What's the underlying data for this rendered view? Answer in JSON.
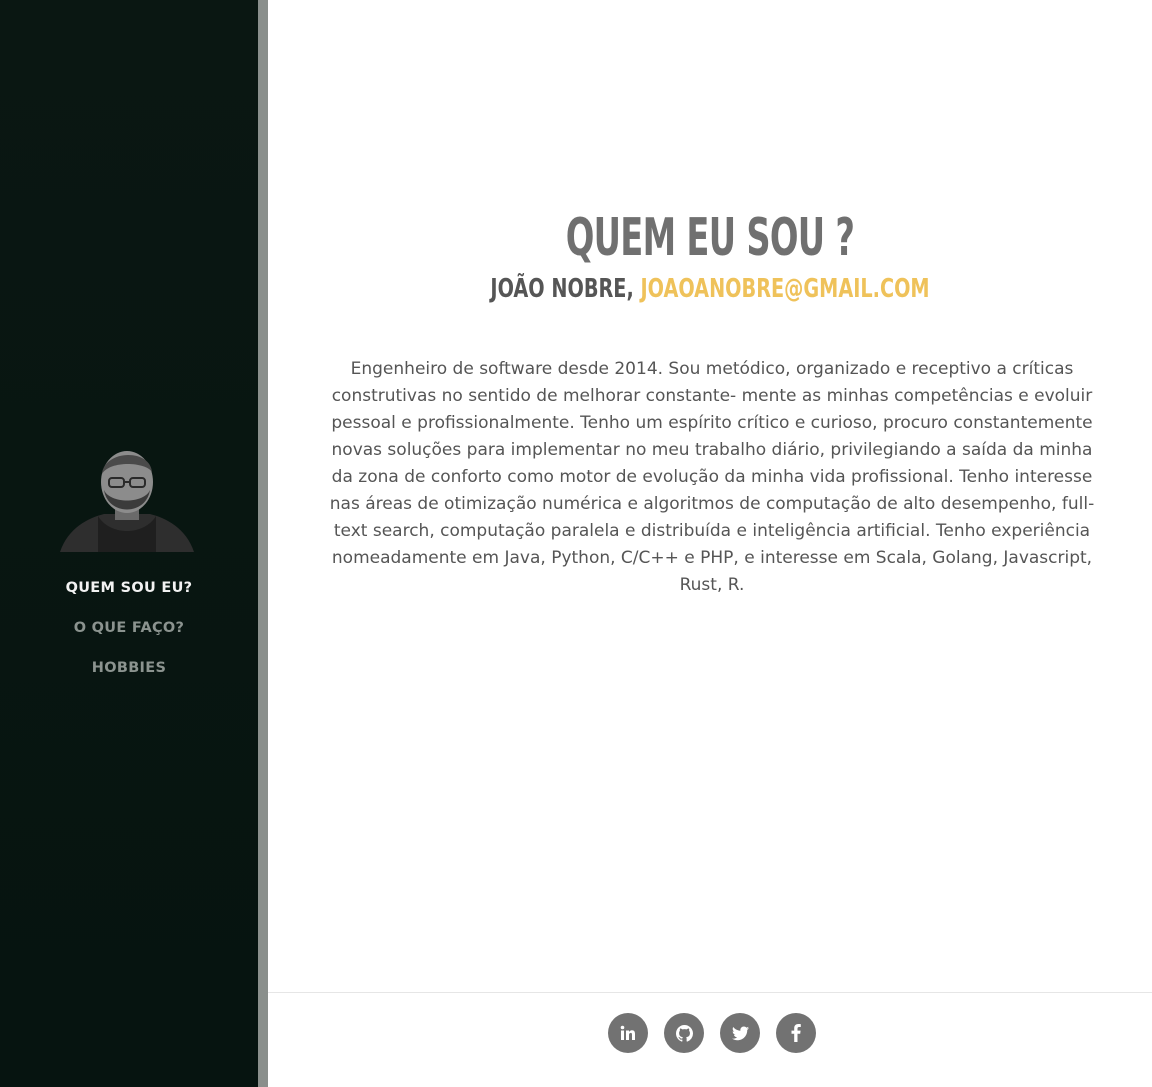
{
  "sidebar": {
    "nav": [
      {
        "label": "QUEM SOU EU?",
        "active": true
      },
      {
        "label": "O QUE FAÇO?",
        "active": false
      },
      {
        "label": "HOBBIES",
        "active": false
      }
    ]
  },
  "main": {
    "heading": "QUEM EU SOU ?",
    "name": "JOÃO NOBRE, ",
    "email": "JOAOANOBRE@GMAIL.COM",
    "bio": "Engenheiro de software desde 2014. Sou metódico, organizado e receptivo a críticas construtivas no sentido de melhorar constante- mente as minhas competências e evoluir pessoal e profissionalmente. Tenho um espírito crítico e curioso, procuro constantemente novas soluções para implementar no meu trabalho diário, privilegiando a saída da minha da zona de conforto como motor de evolução da minha vida profissional. Tenho interesse nas áreas de otimização numérica e algoritmos de computação de alto desempenho, full-text search, computação paralela e distribuída e inteligência artificial. Tenho experiência nomeadamente em Java, Python, C/C++ e PHP, e interesse em Scala, Golang, Javascript, Rust, R."
  },
  "footer": {
    "social": [
      "linkedin-icon",
      "github-icon",
      "twitter-icon",
      "facebook-icon"
    ]
  },
  "colors": {
    "sidebar_bg": "#08150f",
    "accent": "#efc25a",
    "heading": "#707070",
    "text": "#555555",
    "social_bg": "#727272"
  }
}
